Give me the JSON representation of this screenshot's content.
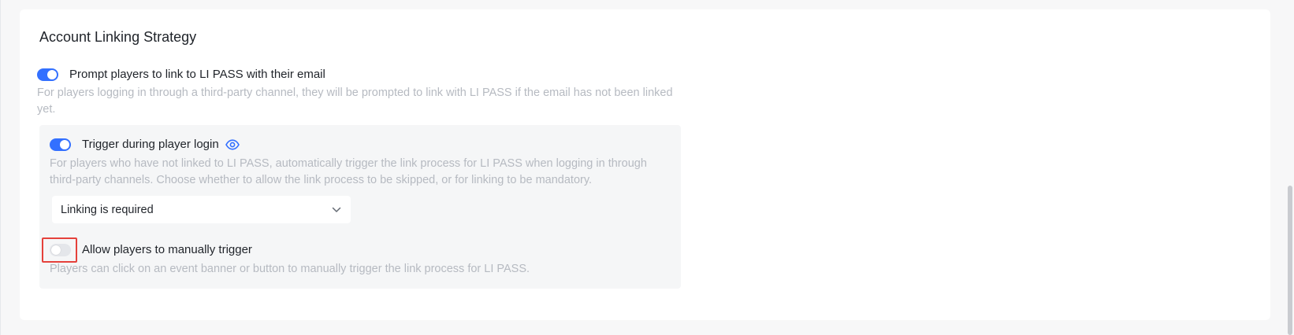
{
  "section": {
    "title": "Account Linking Strategy"
  },
  "prompt_email": {
    "enabled": true,
    "label": "Prompt players to link to LI PASS with their email",
    "description_line1": "For players logging in through a third-party channel, they will be prompted to link with LI PASS if the email has not been linked",
    "description_line2": "yet."
  },
  "trigger_login": {
    "enabled": true,
    "label": "Trigger during player login",
    "icon": "eye-icon",
    "description_line1": "For players who have not linked to LI PASS, automatically trigger the link process for LI PASS when logging in through",
    "description_line2": "third-party channels. Choose whether to allow the link process to be skipped, or for linking to be mandatory.",
    "select_value": "Linking is required"
  },
  "manual_trigger": {
    "enabled": false,
    "label": "Allow players to manually trigger",
    "description": "Players can click on an event banner or button to manually trigger the link process for LI PASS."
  },
  "colors": {
    "accent": "#3370ff",
    "highlight": "#e5413b",
    "muted_text": "#b6bac1"
  }
}
